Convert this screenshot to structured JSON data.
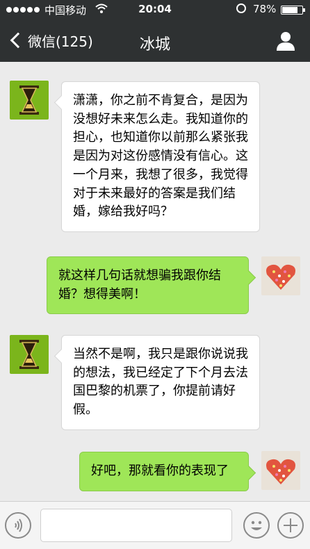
{
  "status_bar": {
    "carrier": "中国移动",
    "time": "20:04",
    "battery_percent": "78%",
    "battery_level": 0.78
  },
  "nav": {
    "back_label": "微信(125)",
    "title": "冰城"
  },
  "messages": [
    {
      "side": "in",
      "avatar": "hourglass-avatar",
      "text": "潇潇，你之前不肯复合，是因为没想好未来怎么走。我知道你的担心，也知道你以前那么紧张我是因为对这份感情没有信心。这一个月来，我想了很多，我觉得对于未来最好的答案是我们结婚，嫁给我好吗？"
    },
    {
      "side": "out",
      "avatar": "heart-avatar",
      "text": "就这样几句话就想骗我跟你结婚？想得美啊！"
    },
    {
      "side": "in",
      "avatar": "hourglass-avatar",
      "text": "当然不是啊，我只是跟你说说我的想法，我已经定了下个月去法国巴黎的机票了，你提前请好假。"
    },
    {
      "side": "out",
      "avatar": "heart-avatar",
      "text": "好吧，那就看你的表现了"
    }
  ],
  "input_bar": {
    "text_value": ""
  },
  "colors": {
    "header_bg": "#2e3132",
    "chat_bg": "#ebebeb",
    "incoming_bubble": "#ffffff",
    "outgoing_bubble": "#9fe658"
  },
  "icons": {
    "back": "chevron-left-icon",
    "profile": "person-icon",
    "voice": "voice-icon",
    "emoji": "emoji-icon",
    "more": "plus-icon",
    "wifi": "wifi-icon",
    "lock": "rotation-lock-icon",
    "battery": "battery-icon"
  }
}
